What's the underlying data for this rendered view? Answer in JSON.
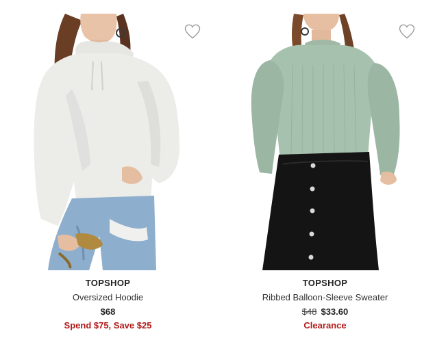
{
  "products": [
    {
      "brand": "TOPSHOP",
      "name": "Oversized Hoodie",
      "price": "$68",
      "promo": "Spend $75, Save $25",
      "image_alt": "Oversized Hoodie"
    },
    {
      "brand": "TOPSHOP",
      "name": "Ribbed Balloon-Sleeve Sweater",
      "original_price": "$48",
      "price": "$33.60",
      "promo": "Clearance",
      "image_alt": "Ribbed Balloon-Sleeve Sweater"
    }
  ],
  "icons": {
    "wishlist": "heart-outline-icon"
  },
  "colors": {
    "promo_red": "#b21a1a",
    "text": "#222222",
    "heart_stroke": "#9a9a9a"
  }
}
